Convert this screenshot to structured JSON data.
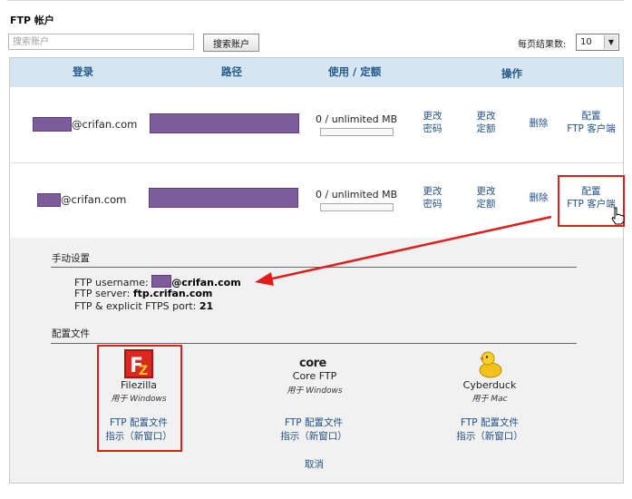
{
  "page": {
    "title": "FTP 帐户",
    "search_placeholder": "搜索账户",
    "search_button": "搜索账户",
    "per_page_label": "每页结果数:",
    "per_page_value": "10"
  },
  "table": {
    "headers": {
      "login": "登录",
      "path": "路径",
      "usage": "使用 / 定额",
      "actions": "操作"
    },
    "rows": [
      {
        "email": "@crifan.com",
        "usage": "0 / unlimited MB",
        "usage_fraction": 0,
        "change_password": [
          "更改",
          "密码"
        ],
        "change_quota": [
          "更改",
          "定额"
        ],
        "delete": "删除",
        "configure": [
          "配置",
          "FTP 客户端"
        ]
      },
      {
        "email": "@crifan.com",
        "usage": "0 / unlimited MB",
        "usage_fraction": 0,
        "change_password": [
          "更改",
          "密码"
        ],
        "change_quota": [
          "更改",
          "定额"
        ],
        "delete": "删除",
        "configure": [
          "配置",
          "FTP 客户端"
        ]
      }
    ]
  },
  "manual": {
    "heading": "手动设置",
    "username_label": "FTP username:",
    "username_value": "@crifan.com",
    "server_label": "FTP server:",
    "server_value": "ftp.crifan.com",
    "port_label": "FTP & explicit FTPS port:",
    "port_value": "21"
  },
  "config_files": {
    "heading": "配置文件",
    "apps": [
      {
        "name": "Filezilla",
        "os": "用于 Windows",
        "link1": "FTP 配置文件",
        "link2": "指示（新窗口）",
        "icon": "filezilla-icon"
      },
      {
        "name": "Core FTP",
        "os": "用于 Windows",
        "link1": "FTP 配置文件",
        "link2": "指示（新窗口）",
        "icon": "coreftp-icon",
        "logo_text": "core"
      },
      {
        "name": "Cyberduck",
        "os": "用于 Mac",
        "link1": "FTP 配置文件",
        "link2": "指示（新窗口）",
        "icon": "cyberduck-icon"
      }
    ],
    "cancel": "取消"
  },
  "colors": {
    "header_bg": "#d5e6f3",
    "link": "#1f4f86",
    "highlight": "#e21b1b",
    "redaction": "#7e5b9c",
    "panel_bg": "#f1f1f1"
  }
}
